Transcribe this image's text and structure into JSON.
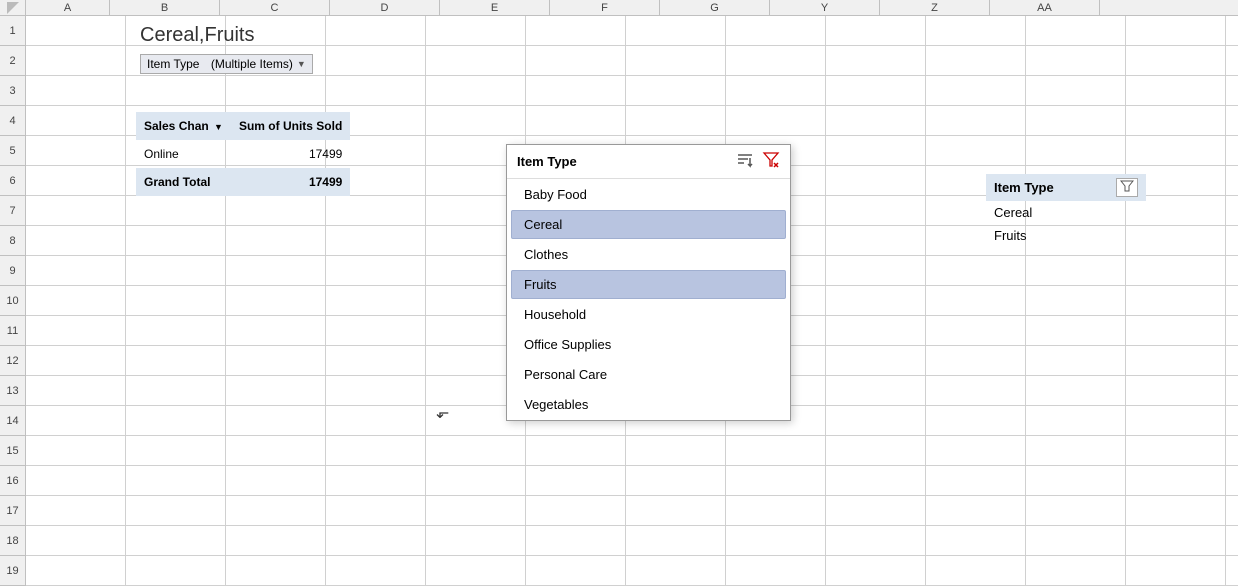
{
  "spreadsheet": {
    "title": "Cereal,Fruits",
    "col_headers": [
      "",
      "A",
      "B",
      "C",
      "D",
      "E",
      "F",
      "G",
      "Y",
      "Z",
      "AA"
    ],
    "row_headers": [
      "1",
      "2",
      "3",
      "4",
      "5",
      "6",
      "7",
      "8",
      "9",
      "10",
      "11",
      "12",
      "13",
      "14",
      "15",
      "16",
      "17",
      "18",
      "19"
    ],
    "filter_label": "Item Type",
    "filter_value": "(Multiple Items)",
    "filter_dropdown_symbol": "▼"
  },
  "pivot_table": {
    "col1_header": "Sales Chan",
    "col2_header": "Sum of Units Sold",
    "rows": [
      {
        "label": "Online",
        "value": "17499"
      }
    ],
    "total_label": "Grand Total",
    "total_value": "17499"
  },
  "filter_popup": {
    "title": "Item Type",
    "items": [
      {
        "label": "Baby Food",
        "selected": false
      },
      {
        "label": "Cereal",
        "selected": true
      },
      {
        "label": "Clothes",
        "selected": false
      },
      {
        "label": "Fruits",
        "selected": true
      },
      {
        "label": "Household",
        "selected": false
      },
      {
        "label": "Office Supplies",
        "selected": false
      },
      {
        "label": "Personal Care",
        "selected": false
      },
      {
        "label": "Vegetables",
        "selected": false
      }
    ],
    "sort_icon": "≋",
    "clear_icon": "⊘"
  },
  "slicer": {
    "title": "Item Type",
    "items": [
      {
        "label": "Cereal"
      },
      {
        "label": "Fruits"
      }
    ]
  }
}
